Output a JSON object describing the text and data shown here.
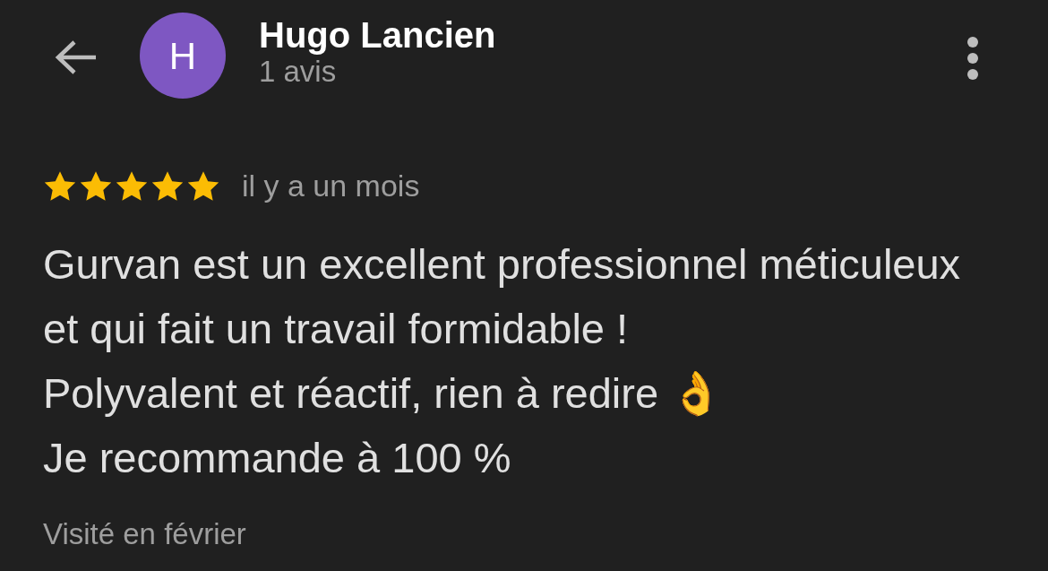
{
  "header": {
    "avatar_letter": "H",
    "name": "Hugo Lancien",
    "subtitle": "1 avis"
  },
  "review": {
    "stars": 5,
    "time": "il y a un mois",
    "paragraphs": [
      "Gurvan est un excellent professionnel méticuleux et qui fait un travail formidable !",
      "Polyvalent et réactif, rien à redire 👌",
      "Je recommande à 100 %"
    ],
    "visit": "Visité en février"
  }
}
